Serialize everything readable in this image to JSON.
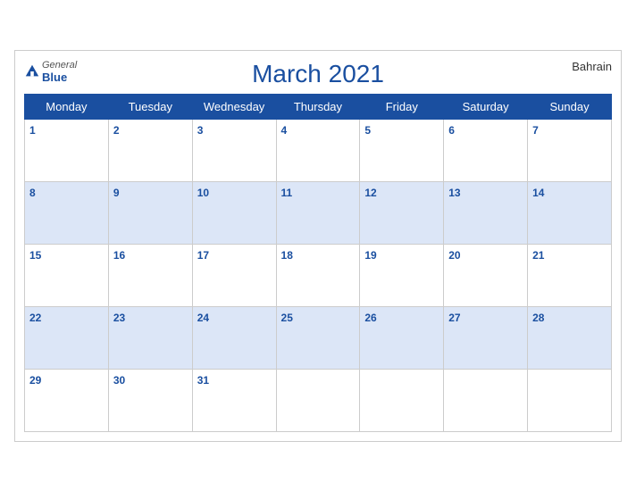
{
  "header": {
    "logo_general": "General",
    "logo_blue": "Blue",
    "title": "March 2021",
    "country": "Bahrain"
  },
  "weekdays": [
    "Monday",
    "Tuesday",
    "Wednesday",
    "Thursday",
    "Friday",
    "Saturday",
    "Sunday"
  ],
  "weeks": [
    [
      1,
      2,
      3,
      4,
      5,
      6,
      7
    ],
    [
      8,
      9,
      10,
      11,
      12,
      13,
      14
    ],
    [
      15,
      16,
      17,
      18,
      19,
      20,
      21
    ],
    [
      22,
      23,
      24,
      25,
      26,
      27,
      28
    ],
    [
      29,
      30,
      31,
      null,
      null,
      null,
      null
    ]
  ]
}
